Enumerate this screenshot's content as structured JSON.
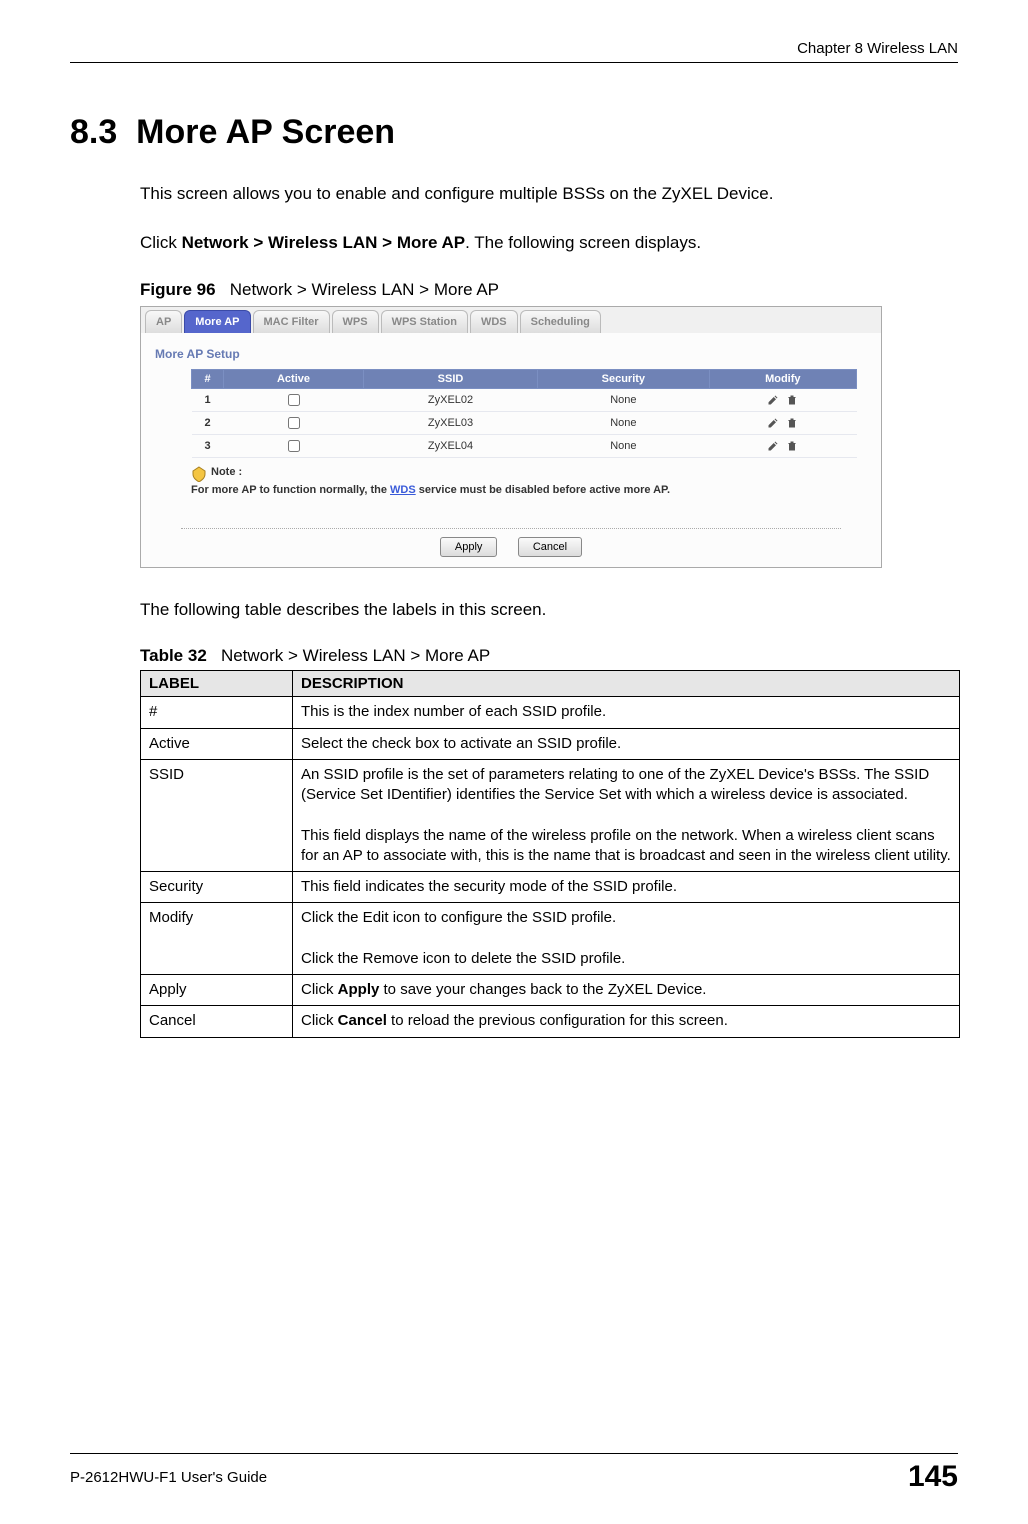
{
  "header": {
    "chapter": "Chapter 8 Wireless LAN"
  },
  "section": {
    "number": "8.3",
    "title": "More AP Screen",
    "intro": "This screen allows you to enable and configure multiple BSSs on the ZyXEL Device.",
    "nav_prefix": "Click ",
    "nav_bold": "Network > Wireless LAN > More AP",
    "nav_suffix": ". The following screen displays."
  },
  "figure": {
    "label": "Figure 96",
    "caption": "Network > Wireless LAN > More AP"
  },
  "screenshot": {
    "tabs": [
      "AP",
      "More AP",
      "MAC Filter",
      "WPS",
      "WPS Station",
      "WDS",
      "Scheduling"
    ],
    "panel_title": "More AP Setup",
    "columns": [
      "#",
      "Active",
      "SSID",
      "Security",
      "Modify"
    ],
    "rows": [
      {
        "num": "1",
        "ssid": "ZyXEL02",
        "security": "None"
      },
      {
        "num": "2",
        "ssid": "ZyXEL03",
        "security": "None"
      },
      {
        "num": "3",
        "ssid": "ZyXEL04",
        "security": "None"
      }
    ],
    "note_label": "Note :",
    "note_text_pre": "For more AP to function normally, the ",
    "note_link": "WDS",
    "note_text_post": " service must be disabled before active more AP.",
    "apply": "Apply",
    "cancel": "Cancel"
  },
  "post_figure": "The following table describes the labels in this screen.",
  "table": {
    "label": "Table 32",
    "caption": "Network > Wireless LAN > More AP",
    "head_label": "LABEL",
    "head_desc": "DESCRIPTION",
    "rows": [
      {
        "label": "#",
        "desc": "This is the index number of each SSID profile."
      },
      {
        "label": "Active",
        "desc": "Select the check box to activate an SSID profile."
      },
      {
        "label": "SSID",
        "desc": "An SSID profile is the set of parameters relating to one of the ZyXEL Device's BSSs. The SSID (Service Set IDentifier) identifies the Service Set with which a wireless device is associated.\n\nThis field displays the name of the wireless profile on the network. When a wireless client scans for an AP to associate with, this is the name that is broadcast and seen in the wireless client utility."
      },
      {
        "label": "Security",
        "desc": "This field indicates the security mode of the SSID profile."
      },
      {
        "label": "Modify",
        "desc": "Click the Edit icon to configure the SSID profile.\n\nClick the Remove icon to delete the SSID profile."
      },
      {
        "label": "Apply",
        "desc_pre": "Click ",
        "desc_bold": "Apply",
        "desc_post": " to save your changes back to the ZyXEL Device."
      },
      {
        "label": "Cancel",
        "desc_pre": "Click ",
        "desc_bold": "Cancel",
        "desc_post": " to reload the previous configuration for this screen."
      }
    ]
  },
  "footer": {
    "guide": "P-2612HWU-F1 User's Guide",
    "page": "145"
  }
}
